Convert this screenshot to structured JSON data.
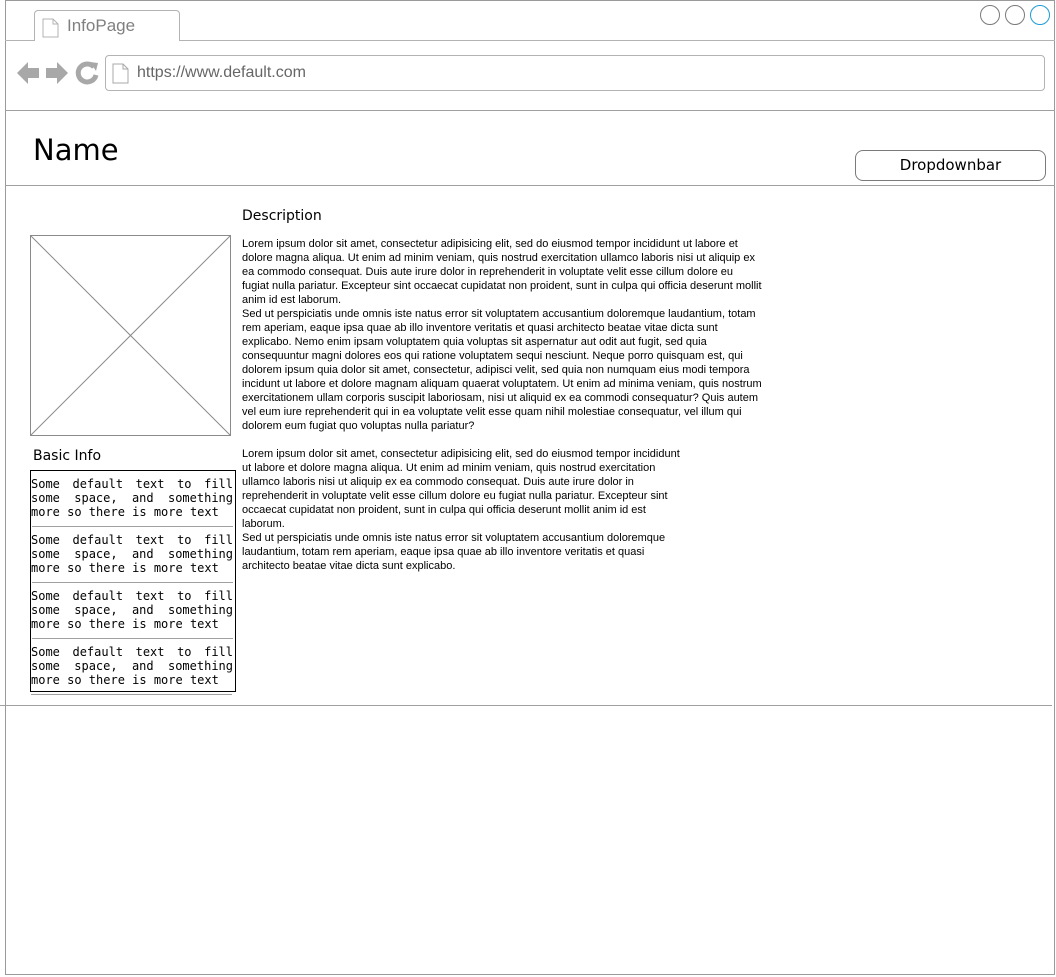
{
  "browser": {
    "tab_label": "InfoPage",
    "url": "https://www.default.com"
  },
  "header": {
    "name": "Name",
    "dropdown_label": "Dropdownbar"
  },
  "basic_info": {
    "title": "Basic Info",
    "items": [
      "Some default text to fill some space, and something more so there is more text",
      "Some default text to fill some space, and something more so there is more text",
      "Some default text to fill some space, and something more so there is more text",
      "Some default text to fill some space, and something more so there is more text"
    ]
  },
  "description": {
    "title": "Description",
    "paragraph_1": "Lorem ipsum dolor sit amet, consectetur adipisicing elit, sed do eiusmod tempor incididunt ut labore et\ndolore magna aliqua. Ut enim ad minim veniam, quis nostrud exercitation ullamco laboris nisi ut aliquip ex\nea commodo consequat. Duis aute irure dolor in reprehenderit in voluptate velit esse cillum dolore eu\nfugiat nulla pariatur. Excepteur sint occaecat cupidatat non proident, sunt in culpa qui officia deserunt mollit\nanim id est laborum.\nSed ut perspiciatis unde omnis iste natus error sit voluptatem accusantium doloremque laudantium, totam\nrem aperiam, eaque ipsa quae ab illo inventore veritatis et quasi architecto beatae vitae dicta sunt\nexplicabo. Nemo enim ipsam voluptatem quia voluptas sit aspernatur aut odit aut fugit, sed quia\nconsequuntur magni dolores eos qui ratione voluptatem sequi nesciunt. Neque porro quisquam est, qui\ndolorem ipsum quia dolor sit amet, consectetur, adipisci velit, sed quia non numquam eius modi tempora\nincidunt ut labore et dolore magnam aliquam quaerat voluptatem. Ut enim ad minima veniam, quis nostrum\nexercitationem ullam corporis suscipit laboriosam, nisi ut aliquid ex ea commodi consequatur? Quis autem\nvel eum iure reprehenderit qui in ea voluptate velit esse quam nihil molestiae consequatur, vel illum qui\ndolorem eum fugiat quo voluptas nulla pariatur?",
    "paragraph_2": "Lorem ipsum dolor sit amet, consectetur adipisicing elit, sed do eiusmod tempor incididunt\nut labore et dolore magna aliqua. Ut enim ad minim veniam, quis nostrud exercitation\nullamco laboris nisi ut aliquip ex ea commodo consequat. Duis aute irure dolor in\nreprehenderit in voluptate velit esse cillum dolore eu fugiat nulla pariatur. Excepteur sint\noccaecat cupidatat non proident, sunt in culpa qui officia deserunt mollit anim id est\nlaborum.\nSed ut perspiciatis unde omnis iste natus error sit voluptatem accusantium doloremque\nlaudantium, totam rem aperiam, eaque ipsa quae ab illo inventore veritatis et quasi\narchitecto beatae vitae dicta sunt explicabo."
  }
}
